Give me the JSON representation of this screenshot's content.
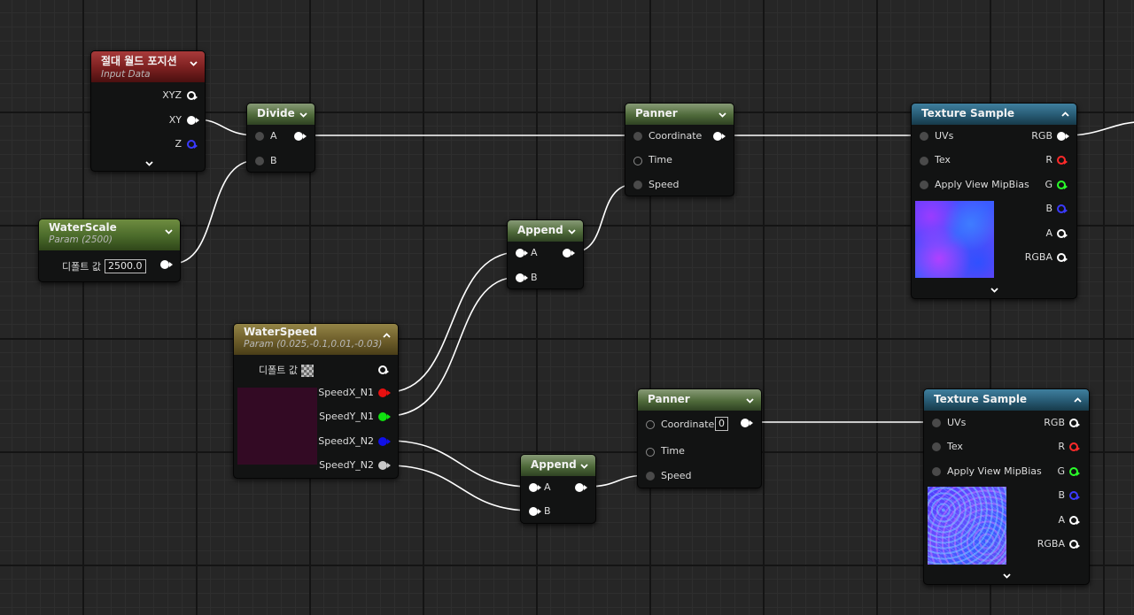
{
  "colors": {
    "wire": "#ffffff",
    "header_green": "#4f6a3a",
    "header_red": "#7a1f1f",
    "header_gold": "#6c5d2a",
    "header_blue": "#275a73",
    "pin_red": "#ff2a2a",
    "pin_green": "#2aff2a",
    "pin_blue": "#3a3aff"
  },
  "nodes": {
    "abs_world_pos": {
      "title": "절대 월드 포지션",
      "subtitle": "Input Data",
      "outputs": [
        "XYZ",
        "XY",
        "Z"
      ],
      "icon": "chevron-down-icon"
    },
    "divide": {
      "title": "Divide",
      "inputs": [
        "A",
        "B"
      ]
    },
    "water_scale": {
      "title": "WaterScale",
      "subtitle": "Param (2500)",
      "default_label": "디폴트 값",
      "default_value": "2500.0"
    },
    "panner1": {
      "title": "Panner",
      "inputs": [
        "Coordinate",
        "Time",
        "Speed"
      ]
    },
    "texture_sample1": {
      "title": "Texture Sample",
      "inputs": [
        "UVs",
        "Tex",
        "Apply View MipBias"
      ],
      "outputs": [
        "RGB",
        "R",
        "G",
        "B",
        "A",
        "RGBA"
      ],
      "preview": "blurred-normal-texture"
    },
    "append1": {
      "title": "Append",
      "inputs": [
        "A",
        "B"
      ]
    },
    "water_speed": {
      "title": "WaterSpeed",
      "subtitle": "Param (0.025,-0.1,0.01,-0.03)",
      "default_label": "디폴트 값",
      "outputs": [
        "SpeedX_N1",
        "SpeedY_N1",
        "SpeedX_N2",
        "SpeedY_N2"
      ],
      "swatch_color": "#330a24"
    },
    "append2": {
      "title": "Append",
      "inputs": [
        "A",
        "B"
      ]
    },
    "panner2": {
      "title": "Panner",
      "inputs": [
        "Coordinate",
        "Time",
        "Speed"
      ],
      "coordinate_value": "0"
    },
    "texture_sample2": {
      "title": "Texture Sample",
      "inputs": [
        "UVs",
        "Tex",
        "Apply View MipBias"
      ],
      "outputs": [
        "RGB",
        "R",
        "G",
        "B",
        "A",
        "RGBA"
      ],
      "preview": "water-normal-texture"
    }
  }
}
